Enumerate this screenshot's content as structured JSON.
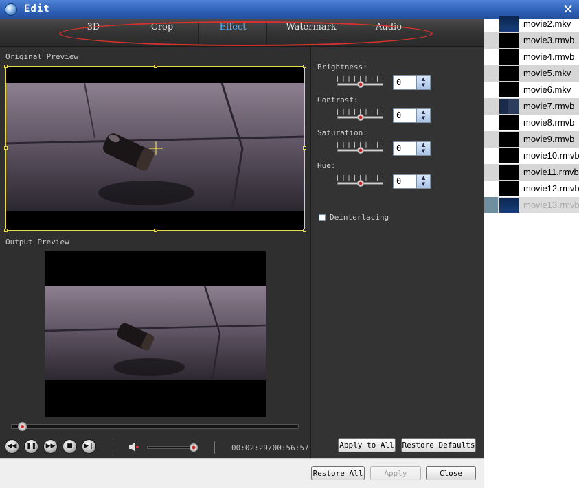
{
  "window": {
    "title": "Edit",
    "close_glyph": "✕"
  },
  "tabs": [
    {
      "label": "3D",
      "active": false
    },
    {
      "label": "Crop",
      "active": false
    },
    {
      "label": "Effect",
      "active": true
    },
    {
      "label": "Watermark",
      "active": false
    },
    {
      "label": "Audio",
      "active": false
    }
  ],
  "preview": {
    "original_label": "Original Preview",
    "output_label": "Output Preview"
  },
  "player": {
    "seek_fraction": 0.035,
    "volume_fraction": 0.93,
    "time_current": "00:02:29",
    "time_total": "00:56:57",
    "time_text": "00:02:29/00:56:57",
    "controls": [
      "rewind-icon",
      "pause-icon",
      "forward-icon",
      "stop-icon",
      "next-icon"
    ],
    "speaker_icon": "speaker-icon"
  },
  "effects": {
    "brightness": {
      "label": "Brightness:",
      "value": "0",
      "fraction": 0.5
    },
    "contrast": {
      "label": "Contrast:",
      "value": "0",
      "fraction": 0.5
    },
    "saturation": {
      "label": "Saturation:",
      "value": "0",
      "fraction": 0.5
    },
    "hue": {
      "label": "Hue:",
      "value": "0",
      "fraction": 0.5
    },
    "deinterlacing": {
      "label": "Deinterlacing",
      "checked": false
    }
  },
  "panel_buttons": {
    "apply_all": "Apply to All",
    "restore_defaults": "Restore Defaults"
  },
  "footer_buttons": {
    "restore_all": "Restore All",
    "apply": "Apply",
    "close": "Close"
  },
  "files": [
    {
      "name": "movie2.mkv",
      "thumb": "blue"
    },
    {
      "name": "movie3.rmvb",
      "thumb": "black"
    },
    {
      "name": "movie4.rmvb",
      "thumb": "black"
    },
    {
      "name": "movie5.mkv",
      "thumb": "black"
    },
    {
      "name": "movie6.mkv",
      "thumb": "black"
    },
    {
      "name": "movie7.rmvb",
      "thumb": "film"
    },
    {
      "name": "movie8.rmvb",
      "thumb": "black"
    },
    {
      "name": "movie9.rmvb",
      "thumb": "black"
    },
    {
      "name": "movie10.rmvb",
      "thumb": "black"
    },
    {
      "name": "movie11.rmvb",
      "thumb": "black"
    },
    {
      "name": "movie12.rmvb",
      "thumb": "black"
    },
    {
      "name": "movie13.rmvb",
      "thumb": "blue",
      "selected": true
    }
  ],
  "colors": {
    "accent": "#4fb3ff",
    "oval": "#d9322b",
    "panel": "#2f2f2f",
    "crop": "#e8d84a"
  }
}
